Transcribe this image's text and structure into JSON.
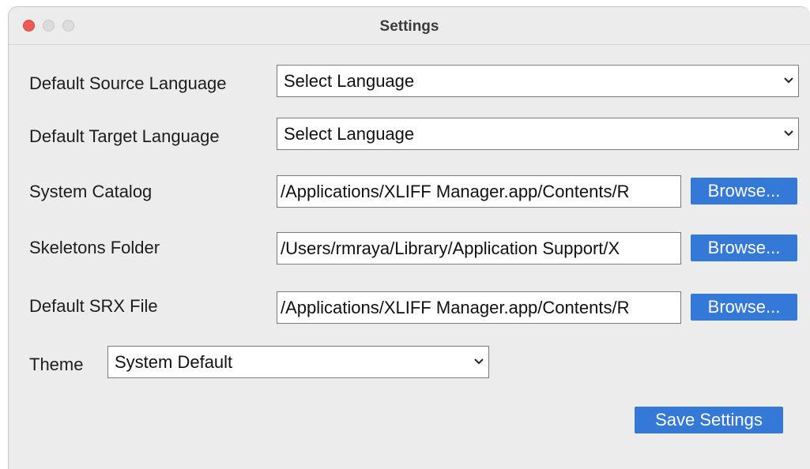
{
  "window": {
    "title": "Settings"
  },
  "form": {
    "source_language": {
      "label": "Default Source Language",
      "value": "Select Language"
    },
    "target_language": {
      "label": "Default Target Language",
      "value": "Select Language"
    },
    "system_catalog": {
      "label": "System Catalog",
      "value": "/Applications/XLIFF Manager.app/Contents/R",
      "button": "Browse..."
    },
    "skeletons_folder": {
      "label": "Skeletons Folder",
      "value": "/Users/rmraya/Library/Application Support/X",
      "button": "Browse..."
    },
    "srx_file": {
      "label": "Default SRX File",
      "value": "/Applications/XLIFF Manager.app/Contents/R",
      "button": "Browse..."
    },
    "theme": {
      "label": "Theme",
      "value": "System Default"
    }
  },
  "actions": {
    "save_label": "Save Settings"
  },
  "colors": {
    "window_bg": "#ececec",
    "accent": "#3478d8",
    "close_button": "#ee5b55"
  },
  "icons": {
    "dropdown": "chevron-down-icon"
  }
}
